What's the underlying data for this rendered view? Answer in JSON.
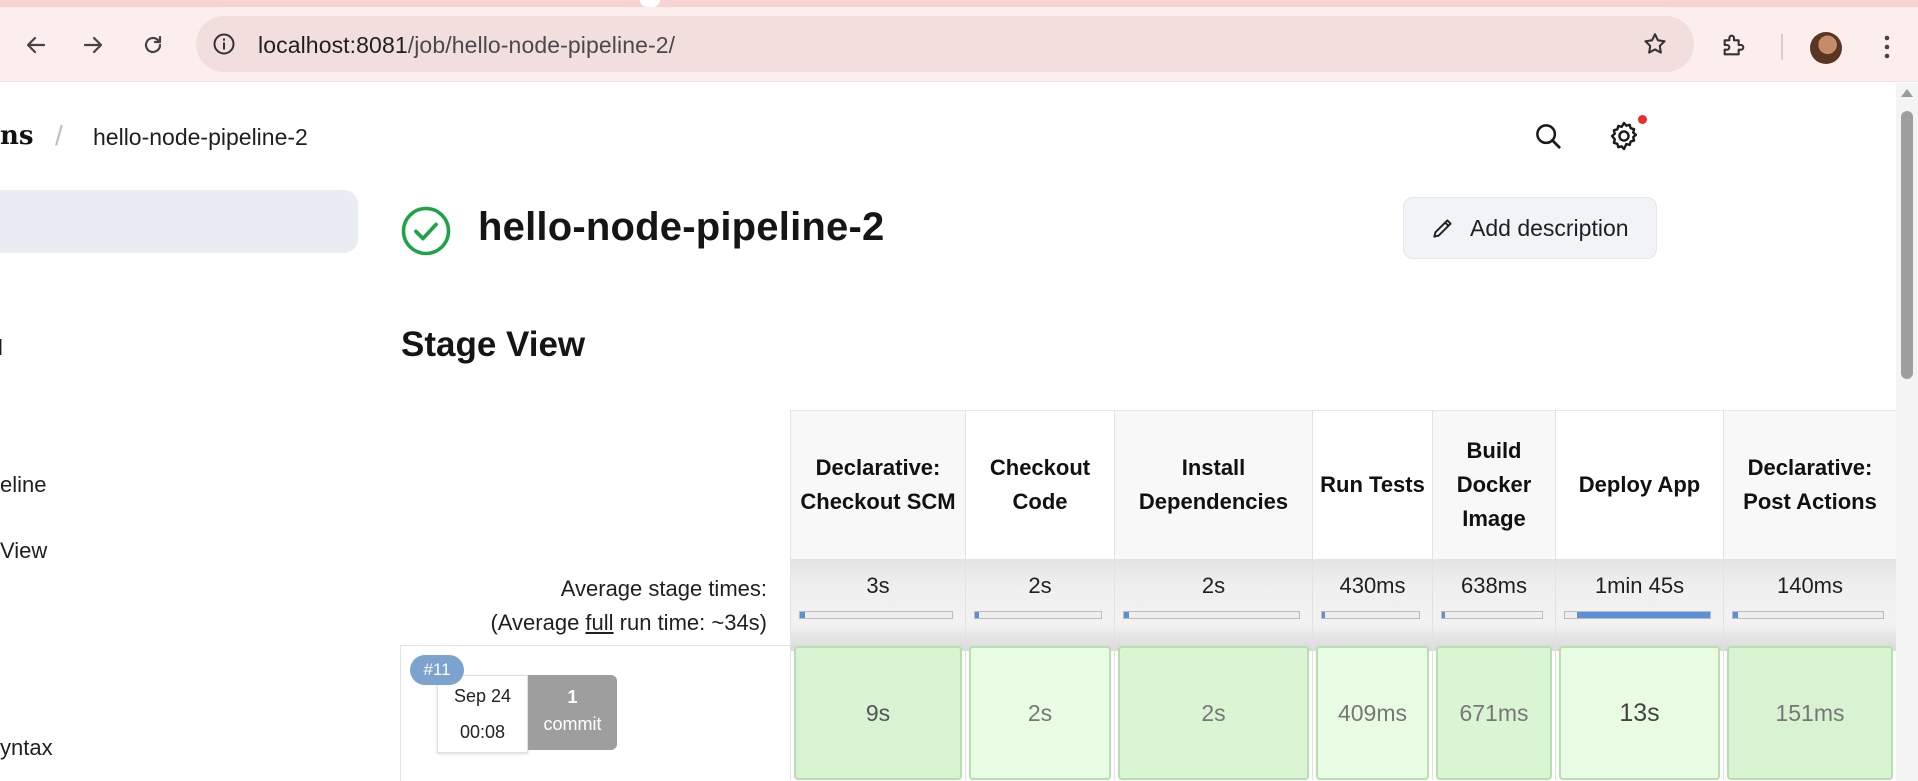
{
  "browser": {
    "url_host": "localhost:8081",
    "url_path": "/job/hello-node-pipeline-2/"
  },
  "breadcrumb": {
    "root_tail": "ns",
    "separator": "/",
    "job": "hello-node-pipeline-2"
  },
  "sidebar": {
    "items": [
      "l",
      "eline",
      "View",
      "yntax"
    ]
  },
  "job": {
    "title": "hello-node-pipeline-2",
    "status": "success",
    "add_description_label": "Add description"
  },
  "stage_view": {
    "title": "Stage View",
    "avg_label": "Average stage times:",
    "avg_full_prefix": "(Average ",
    "avg_full_word": "full",
    "avg_full_suffix": " run time: ~34s)",
    "stages": [
      {
        "name": "Declarative: Checkout SCM",
        "avg": "3s",
        "avg_fraction": 0.03,
        "run": "9s"
      },
      {
        "name": "Checkout Code",
        "avg": "2s",
        "avg_fraction": 0.02,
        "run": "2s"
      },
      {
        "name": "Install Dependencies",
        "avg": "2s",
        "avg_fraction": 0.02,
        "run": "2s"
      },
      {
        "name": "Run Tests",
        "avg": "430ms",
        "avg_fraction": 0.01,
        "run": "409ms"
      },
      {
        "name": "Build Docker Image",
        "avg": "638ms",
        "avg_fraction": 0.01,
        "run": "671ms"
      },
      {
        "name": "Deploy App",
        "avg": "1min 45s",
        "avg_fraction": 1.0,
        "run": "13s"
      },
      {
        "name": "Declarative: Post Actions",
        "avg": "140ms",
        "avg_fraction": 0.01,
        "run": "151ms"
      }
    ],
    "builds": [
      {
        "number": "#11",
        "date": "Sep 24",
        "time": "00:08",
        "commit_count": "1",
        "commit_label": "commit"
      }
    ]
  },
  "colors": {
    "success_green": "#1ea446",
    "stage_success_bg": "#d7f3d2",
    "avg_bar_fill": "#5b8fd6",
    "build_badge": "#7ca2ce"
  },
  "icons": [
    "back-arrow-icon",
    "forward-arrow-icon",
    "reload-icon",
    "site-info-icon",
    "bookmark-star-icon",
    "extensions-icon",
    "profile-avatar",
    "kebab-menu-icon",
    "search-icon",
    "gear-icon",
    "check-circle-icon",
    "pencil-icon"
  ]
}
